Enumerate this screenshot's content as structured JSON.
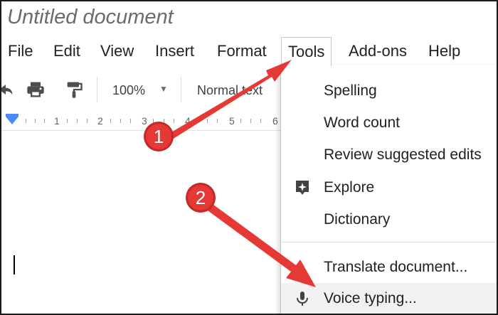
{
  "document": {
    "title": "Untitled document"
  },
  "menubar": {
    "items": [
      {
        "label": "File"
      },
      {
        "label": "Edit"
      },
      {
        "label": "View"
      },
      {
        "label": "Insert"
      },
      {
        "label": "Format"
      },
      {
        "label": "Tools",
        "active": true
      },
      {
        "label": "Add-ons"
      },
      {
        "label": "Help"
      }
    ]
  },
  "toolbar": {
    "zoom": "100%",
    "paragraph_style": "Normal text",
    "icons": [
      "undo-icon",
      "print-icon",
      "paint-format-icon",
      "dropdown-caret-icon"
    ]
  },
  "ruler": {
    "numbers": [
      "1",
      "2",
      "3",
      "4",
      "5",
      "6"
    ]
  },
  "tools_menu": {
    "items": [
      {
        "label": "Spelling",
        "icon": ""
      },
      {
        "label": "Word count",
        "icon": ""
      },
      {
        "label": "Review suggested edits",
        "icon": ""
      },
      {
        "label": "Explore",
        "icon": "explore-icon"
      },
      {
        "label": "Dictionary",
        "icon": ""
      },
      {
        "label": "Translate document...",
        "icon": ""
      },
      {
        "label": "Voice typing...",
        "icon": "microphone-icon",
        "highlighted": true
      }
    ]
  },
  "annotations": {
    "badge_1": "1",
    "badge_2": "2",
    "color": "#e53935"
  }
}
